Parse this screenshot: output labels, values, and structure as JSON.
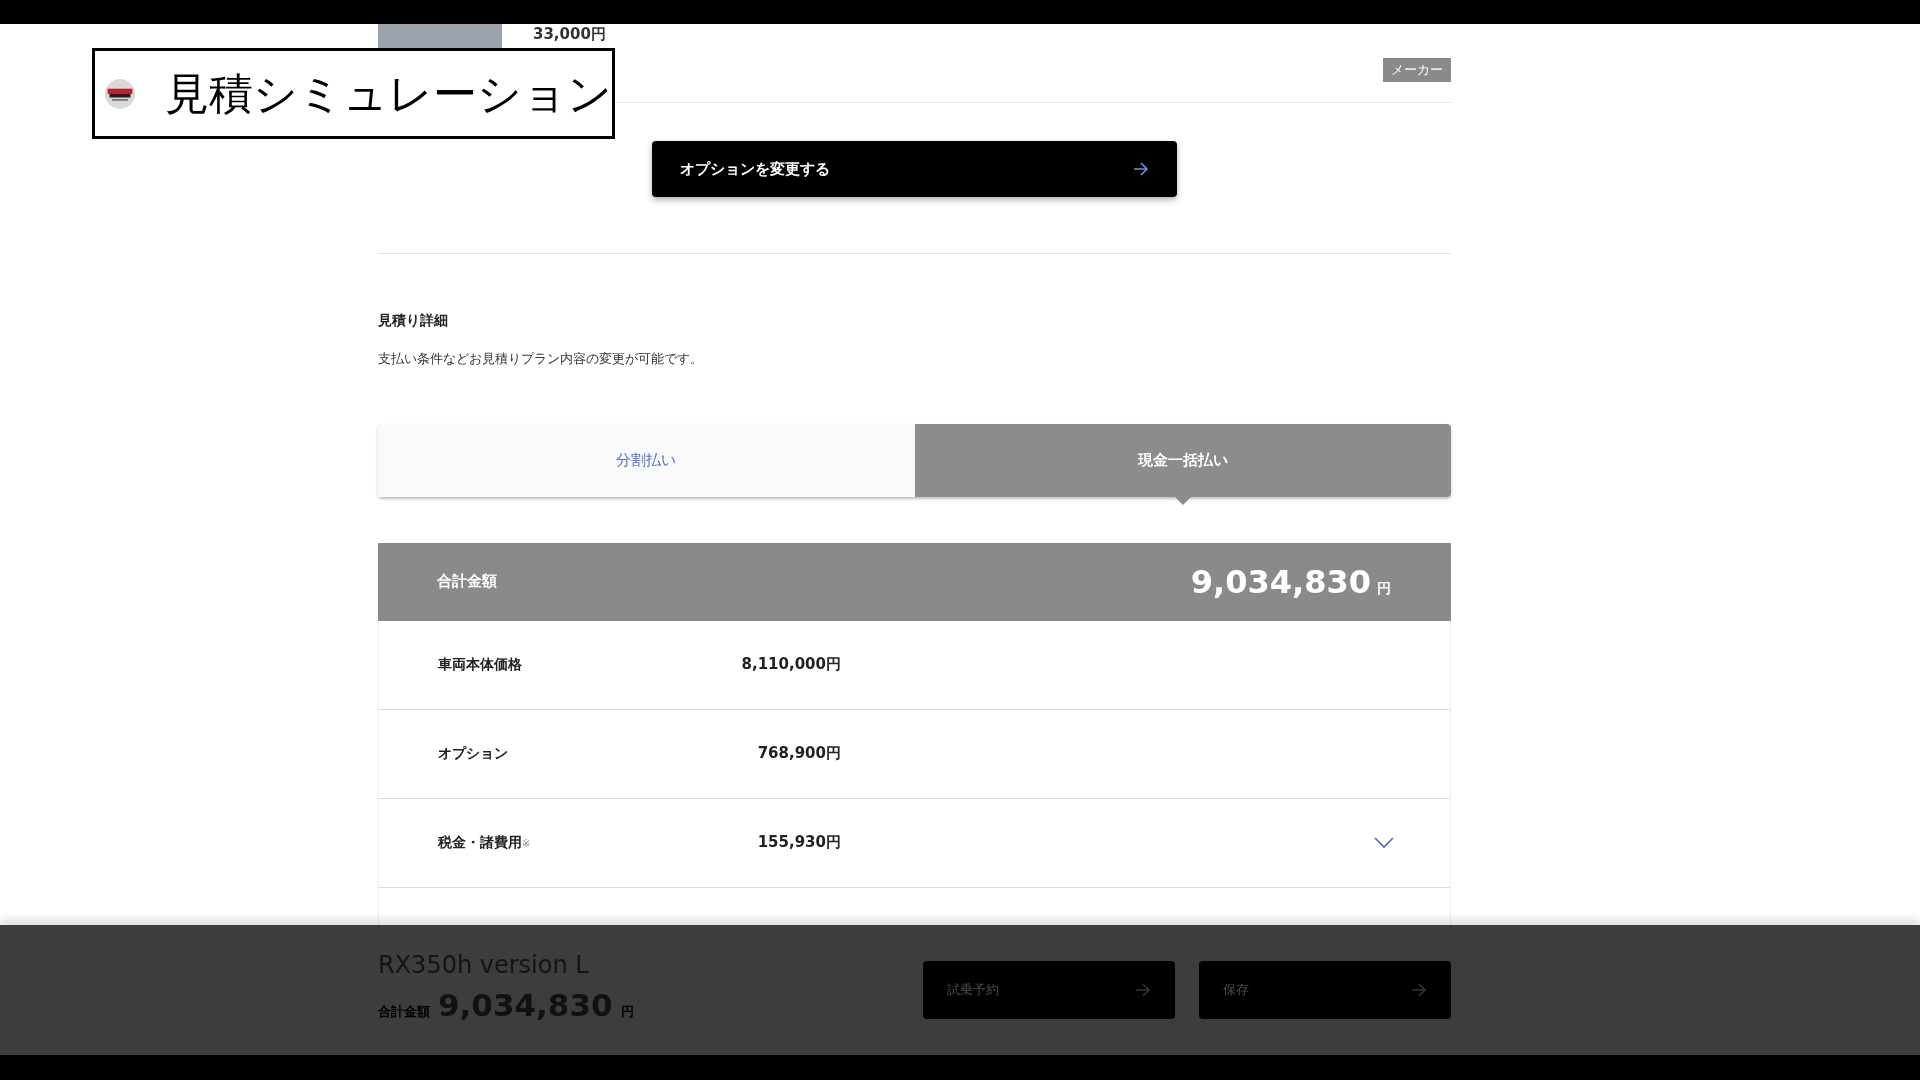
{
  "overlay": {
    "title": "見積シミュレーション"
  },
  "option_item": {
    "price": "33,000円",
    "badge": "メーカー"
  },
  "change_options_button": {
    "label": "オプションを変更する"
  },
  "estimate_details": {
    "heading": "見積り詳細",
    "description": "支払い条件などお見積りプラン内容の変更が可能です。"
  },
  "payment_tabs": [
    {
      "label": "分割払い",
      "selected": false
    },
    {
      "label": "現金一括払い",
      "selected": true
    }
  ],
  "total": {
    "label": "合計金額",
    "amount": "9,034,830",
    "unit": "円"
  },
  "breakdown": [
    {
      "label": "車両本体価格",
      "value": "8,110,000円",
      "expandable": false
    },
    {
      "label": "オプション",
      "value": "768,900円",
      "expandable": false
    },
    {
      "label": "税金・諸費用",
      "note": "※",
      "value": "155,930円",
      "expandable": true
    }
  ],
  "footer_bar": {
    "model": "RX350h version L",
    "total_label": "合計金額",
    "amount": "9,034,830",
    "unit": "円",
    "buttons": [
      "試乗予約",
      "保存"
    ]
  }
}
